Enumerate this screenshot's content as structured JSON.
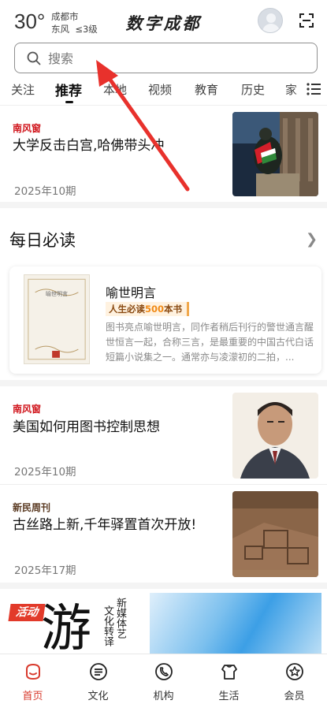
{
  "header": {
    "temperature": "30°",
    "city": "成都市",
    "wind": "东风",
    "wind_level": "≤3级",
    "app_title": "数字成都"
  },
  "search": {
    "placeholder": "搜索"
  },
  "tabs": [
    {
      "label": "关注",
      "active": false
    },
    {
      "label": "推荐",
      "active": true
    },
    {
      "label": "本地",
      "active": false
    },
    {
      "label": "视频",
      "active": false
    },
    {
      "label": "教育",
      "active": false
    },
    {
      "label": "历史",
      "active": false
    },
    {
      "label": "家",
      "active": false
    }
  ],
  "articles": [
    {
      "source": "南风窗",
      "title": "大学反击白宫,哈佛带头冲",
      "issue": "2025年10期"
    },
    {
      "source": "南风窗",
      "title": "美国如何用图书控制思想",
      "issue": "2025年10期"
    },
    {
      "source": "新民周刊",
      "title": "古丝路上新,千年驿置首次开放!",
      "issue": "2025年17期"
    }
  ],
  "daily": {
    "title": "每日必读",
    "book": {
      "name": "喻世明言",
      "cover_title": "喻世明言",
      "badge_prefix": "人生必读",
      "badge_number": "500",
      "badge_suffix": "本书",
      "description": "图书亮点喻世明言，同作者稍后刊行的警世通言醒世恒言一起，合称三言，是最重要的中国古代白话短篇小说集之一。通常亦与凌濛初的二拍，..."
    }
  },
  "banner": {
    "tag": "活动",
    "big_char": "游",
    "line1": "文化转译",
    "line2": "新媒体艺"
  },
  "bottom_nav": [
    {
      "label": "首页",
      "icon": "home-icon",
      "active": true
    },
    {
      "label": "文化",
      "icon": "culture-icon",
      "active": false
    },
    {
      "label": "机构",
      "icon": "institution-icon",
      "active": false
    },
    {
      "label": "生活",
      "icon": "life-icon",
      "active": false
    },
    {
      "label": "会员",
      "icon": "member-icon",
      "active": false
    }
  ],
  "colors": {
    "accent": "#d83a2d",
    "source_red": "#d0141b",
    "annotation_arrow": "#e8312c"
  }
}
